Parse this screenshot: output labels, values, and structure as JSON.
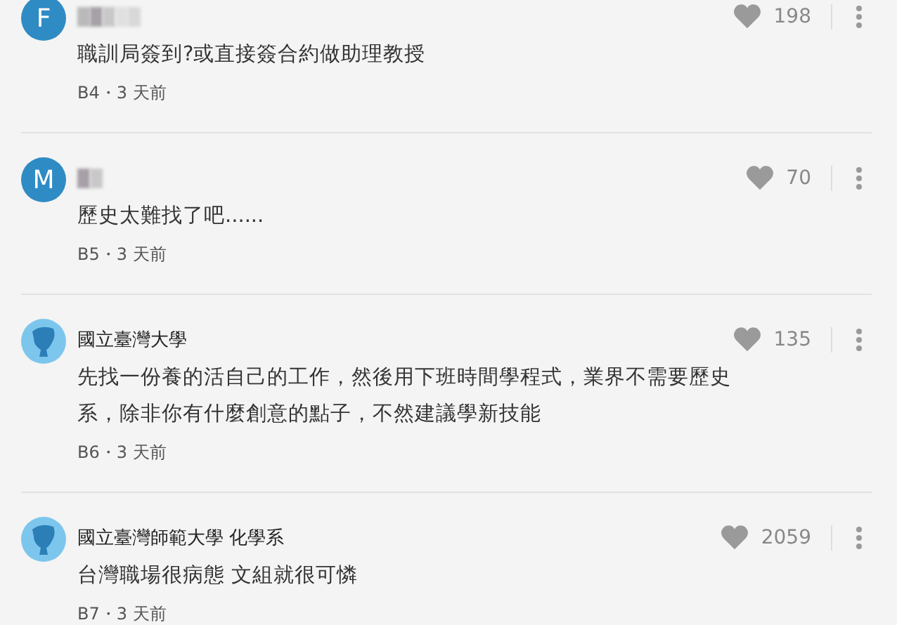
{
  "comments": [
    {
      "avatar": {
        "kind": "letter",
        "letter": "F"
      },
      "author": {
        "kind": "hidden_long"
      },
      "body": "職訓局簽到?或直接簽合約做助理教授",
      "meta": "B4・3 天前",
      "likes": "198"
    },
    {
      "avatar": {
        "kind": "letter",
        "letter": "M"
      },
      "author": {
        "kind": "hidden_short"
      },
      "body": "歷史太難找了吧......",
      "meta": "B5・3 天前",
      "likes": "70"
    },
    {
      "avatar": {
        "kind": "school"
      },
      "author": {
        "kind": "name",
        "name": "國立臺灣大學"
      },
      "body": "先找一份養的活自己的工作，然後用下班時間學程式，業界不需要歷史系，除非你有什麼創意的點子，不然建議學新技能",
      "meta": "B6・3 天前",
      "likes": "135"
    },
    {
      "avatar": {
        "kind": "school"
      },
      "author": {
        "kind": "name",
        "name": "國立臺灣師範大學 化學系"
      },
      "body": "台灣職場很病態 文組就很可憐",
      "meta": "B7・3 天前",
      "likes": "2059"
    }
  ]
}
